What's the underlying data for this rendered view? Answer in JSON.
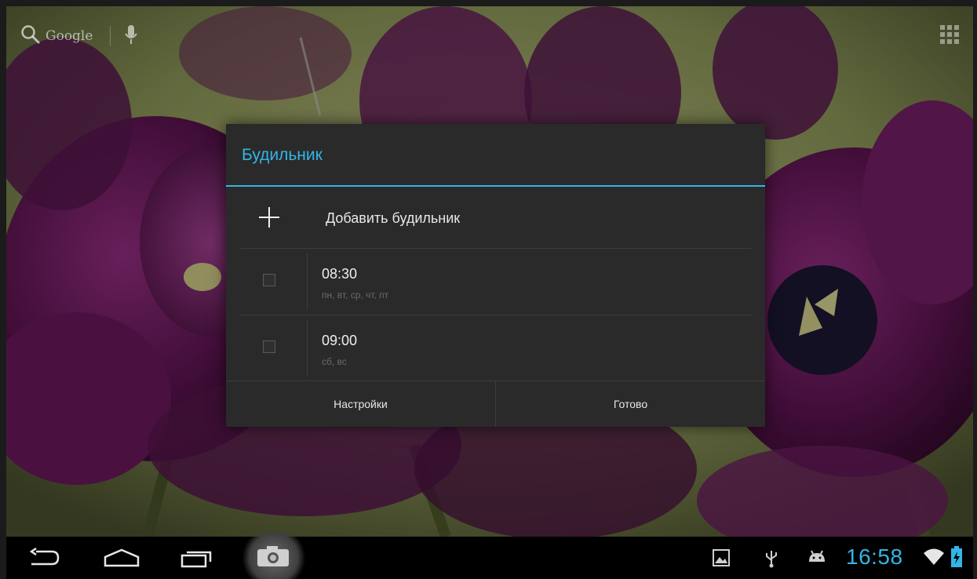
{
  "launcher": {
    "search_label": "Google"
  },
  "dialog": {
    "title": "Будильник",
    "add_label": "Добавить будильник",
    "alarms": [
      {
        "time": "08:30",
        "days": "пн, вт, ср, чт, пт",
        "enabled": false
      },
      {
        "time": "09:00",
        "days": "сб, вс",
        "enabled": false
      }
    ],
    "settings_label": "Настройки",
    "done_label": "Готово"
  },
  "statusbar": {
    "clock": "16:58",
    "icons": [
      "gallery-icon",
      "usb-icon",
      "android-debug-icon",
      "wifi-icon",
      "battery-charging-icon"
    ]
  },
  "navbar": {
    "icons": [
      "back-icon",
      "home-icon",
      "recents-icon",
      "camera-icon"
    ]
  },
  "colors": {
    "accent": "#33b5e5",
    "dialog_bg": "#2a2a2a"
  }
}
